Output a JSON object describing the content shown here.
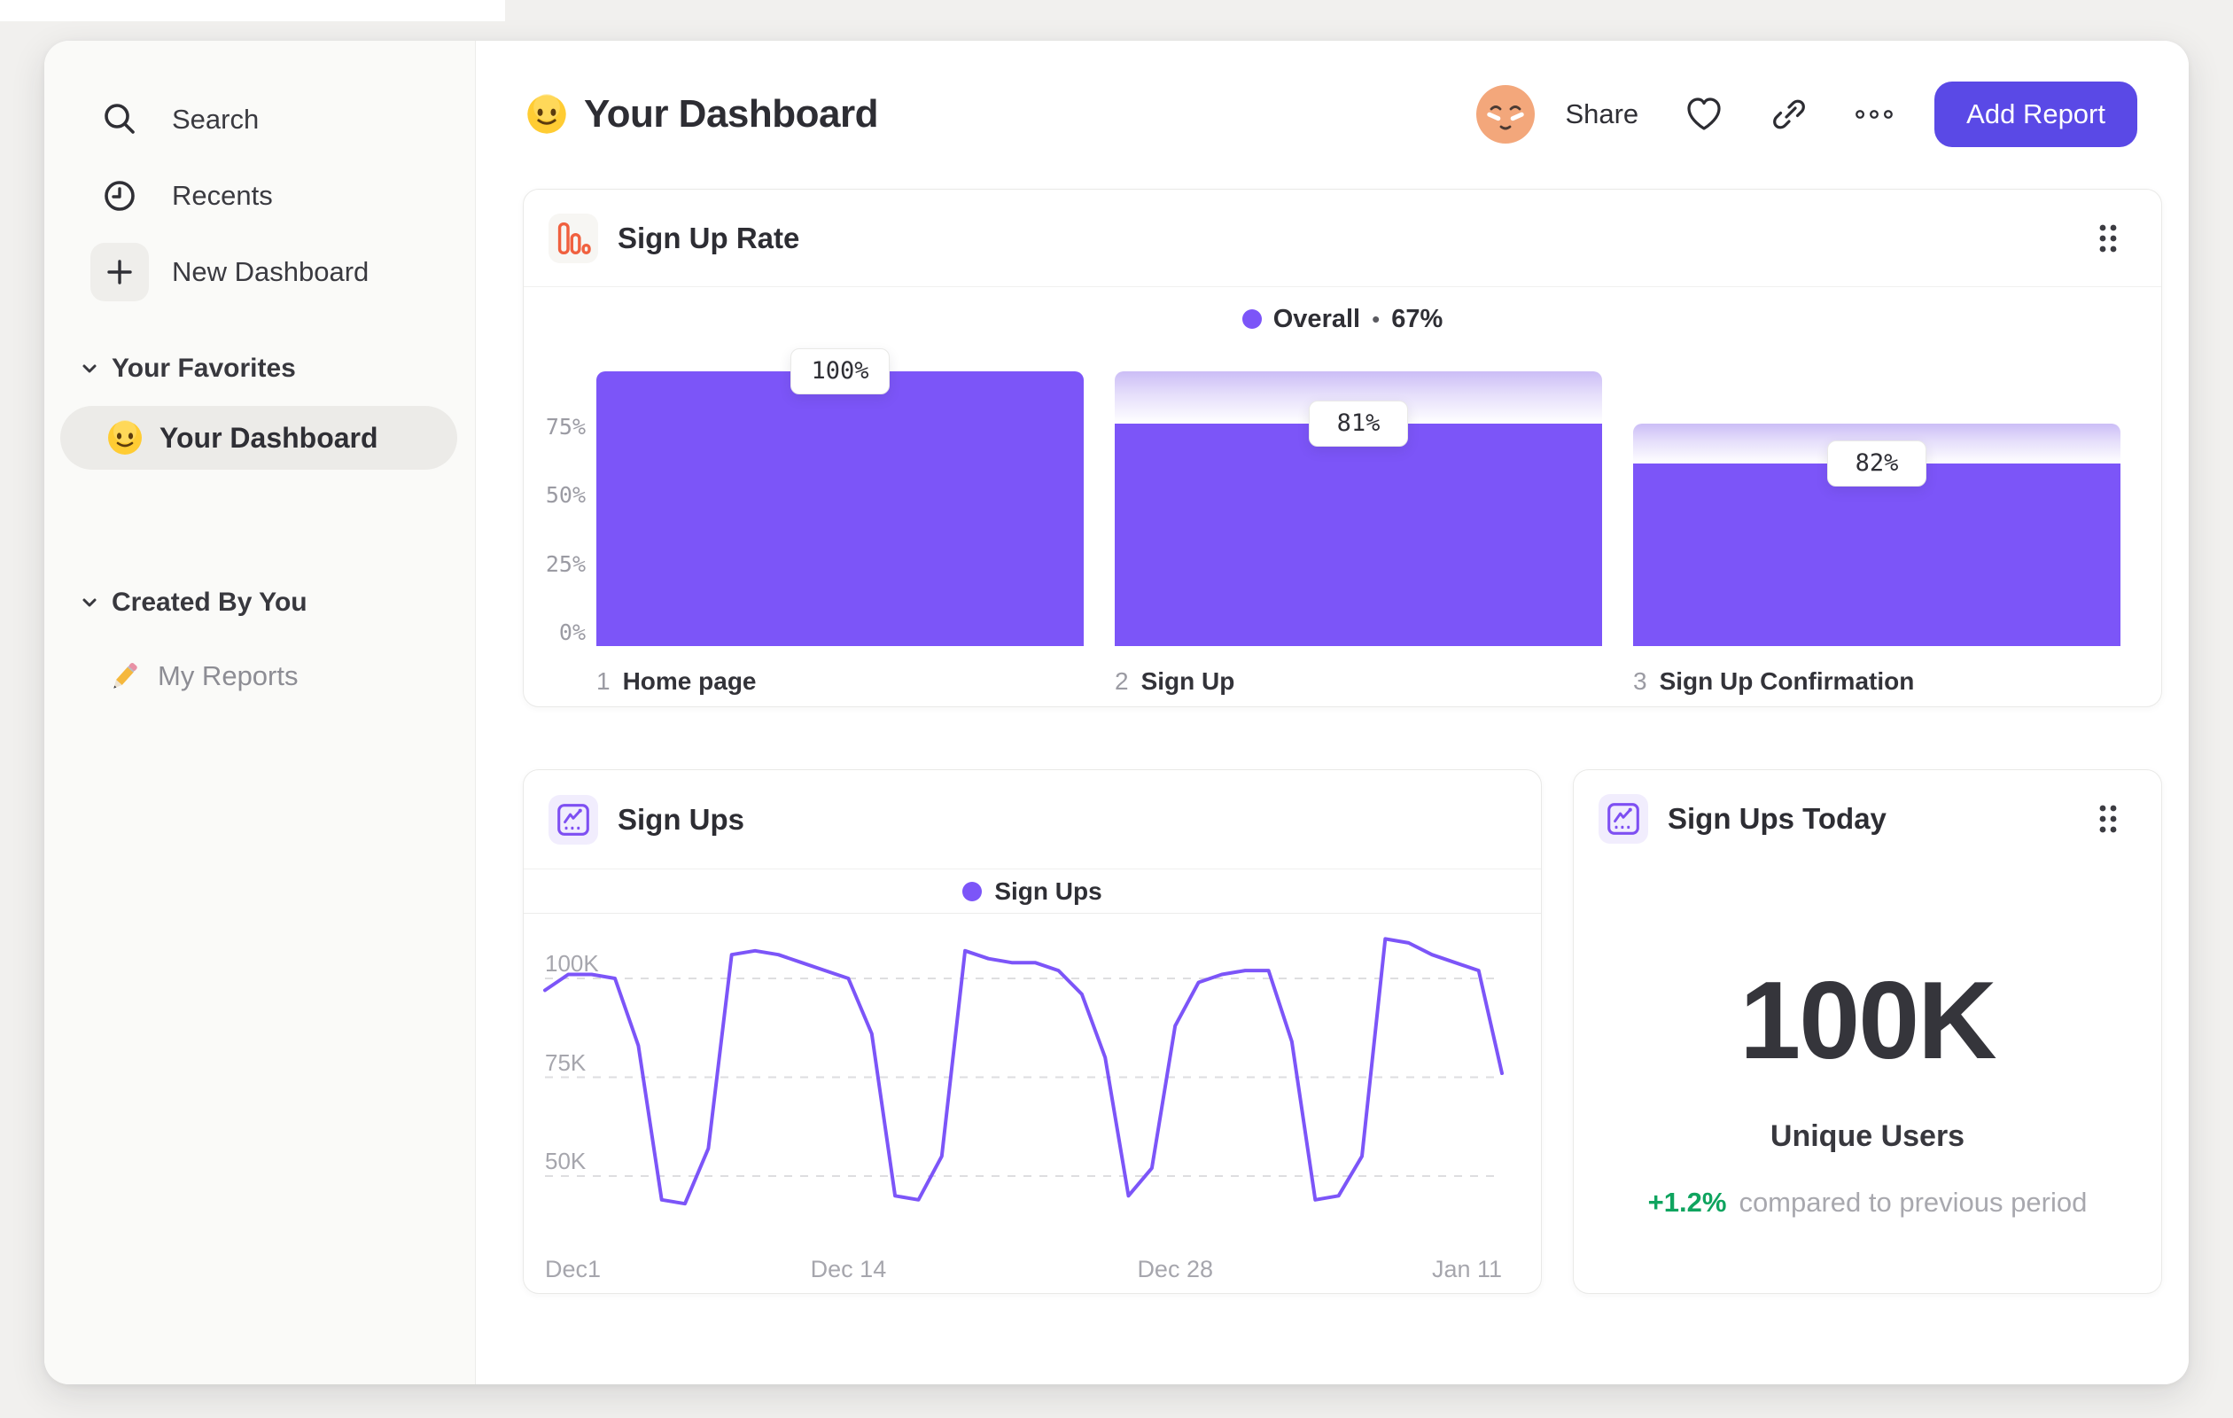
{
  "colors": {
    "accent_purple": "#7C55F8",
    "button_purple": "#5A49E6",
    "funnel_gradient_top": "#CBBDF6",
    "positive_green": "#0FA45F",
    "orange_icon": "#F0603F",
    "sidebar_bg": "#FAFAF8",
    "text_dark": "#2D2D33",
    "text_gray": "#9B9BA3"
  },
  "sidebar": {
    "items": [
      {
        "label": "Search",
        "icon": "search-icon"
      },
      {
        "label": "Recents",
        "icon": "clock-icon"
      },
      {
        "label": "New Dashboard",
        "icon": "plus-icon"
      }
    ],
    "sections": [
      {
        "label": "Your Favorites",
        "items": [
          {
            "label": "Your Dashboard",
            "icon": "smiley-emoji",
            "selected": true
          }
        ]
      },
      {
        "label": "Created By You",
        "items": [
          {
            "label": "My Reports",
            "icon": "pencil-emoji",
            "selected": false
          }
        ]
      }
    ]
  },
  "header": {
    "title": "Your Dashboard",
    "title_emoji": "smiley",
    "share_label": "Share",
    "add_report_label": "Add Report",
    "icons": [
      "avatar",
      "heart-icon",
      "link-icon",
      "more-dots-icon"
    ]
  },
  "cards": {
    "funnel": {
      "title": "Sign Up Rate",
      "icon": "funnel-bars-icon",
      "legend": {
        "name": "Overall",
        "separator": "•",
        "value": "67%"
      },
      "chart_data": {
        "type": "bar",
        "subtype": "funnel",
        "title": "Sign Up Rate",
        "overall_conversion": "67%",
        "y_ticks": [
          {
            "label": "75%",
            "value": 75
          },
          {
            "label": "50%",
            "value": 50
          },
          {
            "label": "25%",
            "value": 25
          },
          {
            "label": "0%",
            "value": 0
          }
        ],
        "ylim": [
          0,
          100
        ],
        "steps": [
          {
            "index": "1",
            "label": "Home page",
            "step_conversion_label": "100%",
            "step_conversion_pct": 100,
            "overall_pct": 100
          },
          {
            "index": "2",
            "label": "Sign Up",
            "step_conversion_label": "81%",
            "step_conversion_pct": 81,
            "overall_pct": 81
          },
          {
            "index": "3",
            "label": "Sign Up Confirmation",
            "step_conversion_label": "82%",
            "step_conversion_pct": 82,
            "overall_pct": 66.4
          }
        ]
      }
    },
    "sign_ups": {
      "title": "Sign Ups",
      "icon": "line-chart-icon",
      "legend": {
        "name": "Sign Ups"
      },
      "chart_data": {
        "type": "line",
        "title": "Sign Ups",
        "series_name": "Sign Ups",
        "unit": "K",
        "ylim_k": [
          35,
          115
        ],
        "y_ticks": [
          {
            "label": "100K",
            "value": 100
          },
          {
            "label": "75K",
            "value": 75
          },
          {
            "label": "50K",
            "value": 50
          }
        ],
        "x_ticks": [
          {
            "label": "Dec1",
            "index": 0
          },
          {
            "label": "Dec 14",
            "index": 13
          },
          {
            "label": "Dec 28",
            "index": 27
          },
          {
            "label": "Jan 11",
            "index": 41
          }
        ],
        "values_k": [
          97,
          101,
          101,
          100,
          83,
          44,
          43,
          57,
          106,
          107,
          106,
          104,
          102,
          100,
          86,
          45,
          44,
          55,
          107,
          105,
          104,
          104,
          102,
          96,
          80,
          45,
          52,
          88,
          99,
          101,
          102,
          102,
          84,
          44,
          45,
          55,
          110,
          109,
          106,
          104,
          102,
          76
        ]
      }
    },
    "stat": {
      "title": "Sign Ups Today",
      "icon": "line-chart-icon",
      "value": "100K",
      "sublabel": "Unique Users",
      "delta": "+1.2%",
      "delta_note": "compared to previous period"
    }
  }
}
